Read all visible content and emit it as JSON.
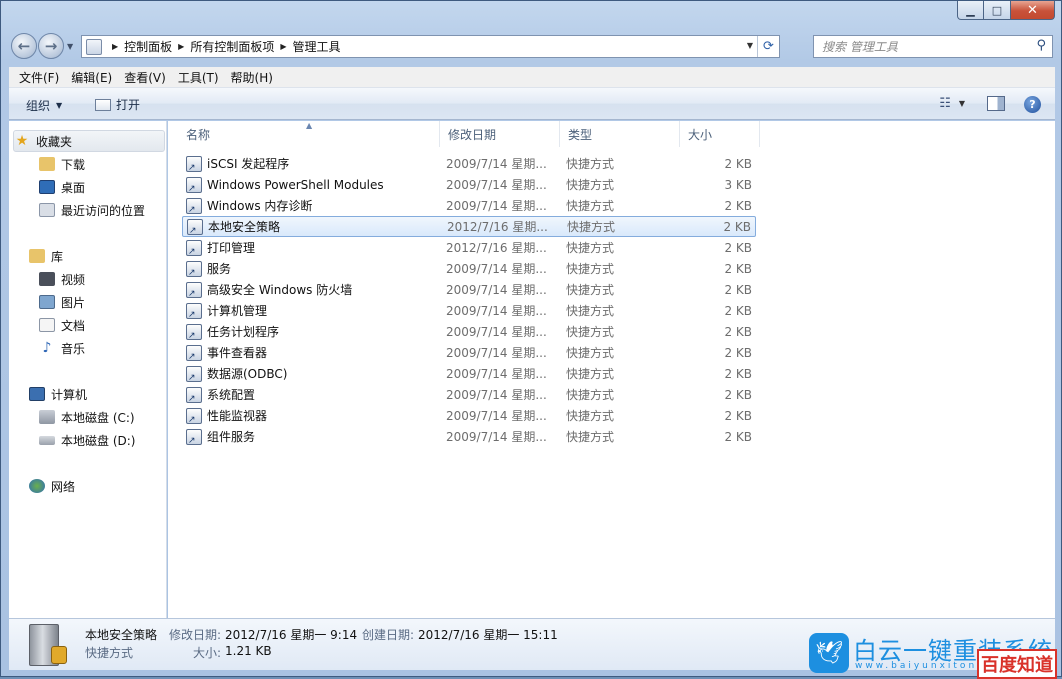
{
  "window": {
    "min_label": "▁",
    "max_label": "□",
    "close_label": "✕"
  },
  "address": {
    "crumbs": [
      "控制面板",
      "所有控制面板项",
      "管理工具"
    ]
  },
  "search": {
    "placeholder": "搜索 管理工具"
  },
  "menu": [
    "文件(F)",
    "编辑(E)",
    "查看(V)",
    "工具(T)",
    "帮助(H)"
  ],
  "toolbar": {
    "organize": "组织",
    "open": "打开"
  },
  "nav": {
    "favorites": "收藏夹",
    "downloads": "下载",
    "desktop": "桌面",
    "recent": "最近访问的位置",
    "libraries": "库",
    "videos": "视频",
    "pictures": "图片",
    "documents": "文档",
    "music": "音乐",
    "computer": "计算机",
    "drive_c": "本地磁盘 (C:)",
    "drive_d": "本地磁盘 (D:)",
    "network": "网络"
  },
  "columns": {
    "name": "名称",
    "date": "修改日期",
    "type": "类型",
    "size": "大小"
  },
  "files": [
    {
      "name": "iSCSI 发起程序",
      "date": "2009/7/14 星期...",
      "type": "快捷方式",
      "size": "2 KB"
    },
    {
      "name": "Windows PowerShell Modules",
      "date": "2009/7/14 星期...",
      "type": "快捷方式",
      "size": "3 KB"
    },
    {
      "name": "Windows 内存诊断",
      "date": "2009/7/14 星期...",
      "type": "快捷方式",
      "size": "2 KB"
    },
    {
      "name": "本地安全策略",
      "date": "2012/7/16 星期...",
      "type": "快捷方式",
      "size": "2 KB"
    },
    {
      "name": "打印管理",
      "date": "2012/7/16 星期...",
      "type": "快捷方式",
      "size": "2 KB"
    },
    {
      "name": "服务",
      "date": "2009/7/14 星期...",
      "type": "快捷方式",
      "size": "2 KB"
    },
    {
      "name": "高级安全 Windows 防火墙",
      "date": "2009/7/14 星期...",
      "type": "快捷方式",
      "size": "2 KB"
    },
    {
      "name": "计算机管理",
      "date": "2009/7/14 星期...",
      "type": "快捷方式",
      "size": "2 KB"
    },
    {
      "name": "任务计划程序",
      "date": "2009/7/14 星期...",
      "type": "快捷方式",
      "size": "2 KB"
    },
    {
      "name": "事件查看器",
      "date": "2009/7/14 星期...",
      "type": "快捷方式",
      "size": "2 KB"
    },
    {
      "name": "数据源(ODBC)",
      "date": "2009/7/14 星期...",
      "type": "快捷方式",
      "size": "2 KB"
    },
    {
      "name": "系统配置",
      "date": "2009/7/14 星期...",
      "type": "快捷方式",
      "size": "2 KB"
    },
    {
      "name": "性能监视器",
      "date": "2009/7/14 星期...",
      "type": "快捷方式",
      "size": "2 KB"
    },
    {
      "name": "组件服务",
      "date": "2009/7/14 星期...",
      "type": "快捷方式",
      "size": "2 KB"
    }
  ],
  "details": {
    "name": "本地安全策略",
    "kind": "快捷方式",
    "modified_label": "修改日期:",
    "modified": "2012/7/16 星期一 9:14",
    "created_label": "创建日期:",
    "created": "2012/7/16 星期一 15:11",
    "size_label": "大小:",
    "size": "1.21 KB"
  },
  "watermark": {
    "title": "白云一键重装系统",
    "url": "www.baiyunxitong.com",
    "badge": "百度知道"
  }
}
